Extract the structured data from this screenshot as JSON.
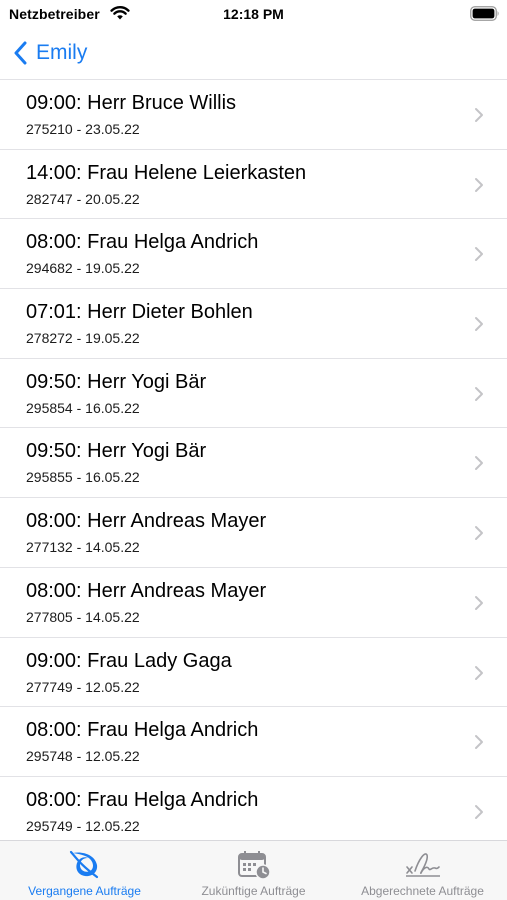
{
  "status": {
    "carrier": "Netzbetreiber",
    "time": "12:18 PM"
  },
  "nav": {
    "back_label": "Emily"
  },
  "orders": [
    {
      "title": "09:00: Herr Bruce Willis",
      "subtitle": "275210 - 23.05.22"
    },
    {
      "title": "14:00: Frau Helene Leierkasten",
      "subtitle": "282747 - 20.05.22"
    },
    {
      "title": "08:00: Frau Helga Andrich",
      "subtitle": "294682 - 19.05.22"
    },
    {
      "title": "07:01: Herr Dieter Bohlen",
      "subtitle": "278272 - 19.05.22"
    },
    {
      "title": "09:50: Herr Yogi Bär",
      "subtitle": "295854 - 16.05.22"
    },
    {
      "title": "09:50: Herr Yogi Bär",
      "subtitle": "295855 - 16.05.22"
    },
    {
      "title": "08:00: Herr Andreas Mayer",
      "subtitle": "277132 - 14.05.22"
    },
    {
      "title": "08:00: Herr Andreas Mayer",
      "subtitle": "277805 - 14.05.22"
    },
    {
      "title": "09:00: Frau Lady Gaga",
      "subtitle": "277749 - 12.05.22"
    },
    {
      "title": "08:00: Frau Helga Andrich",
      "subtitle": "295748 - 12.05.22"
    },
    {
      "title": "08:00: Frau Helga Andrich",
      "subtitle": "295749 - 12.05.22"
    }
  ],
  "tabs": [
    {
      "label": "Vergangene Aufträge",
      "icon": "leaf-icon",
      "active": true
    },
    {
      "label": "Zukünftige Aufträge",
      "icon": "calendar-clock-icon",
      "active": false
    },
    {
      "label": "Abgerechnete Aufträge",
      "icon": "signature-icon",
      "active": false
    }
  ],
  "colors": {
    "accent": "#1a7cf1",
    "inactive": "#8e8e93",
    "chevron": "#c4c4c7"
  }
}
